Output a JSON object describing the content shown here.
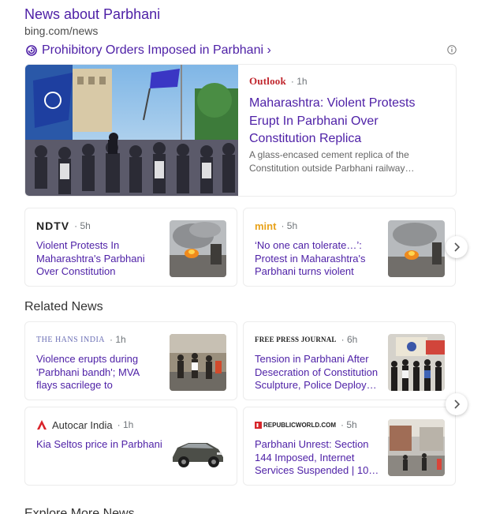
{
  "header": {
    "title": "News about Parbhani",
    "source": "bing.com/news"
  },
  "topic": {
    "label": "Prohibitory Orders Imposed in Parbhani ›"
  },
  "hero": {
    "publisher": "Outlook",
    "time": "· 1h",
    "title": "Maharashtra: Violent Protests Erupt In Parbhani Over Constitution Replica Vandalism;…",
    "snippet": "A glass-encased cement replica of the Constitution outside Parbhani railway…"
  },
  "top_cards": [
    {
      "publisher": "NDTV",
      "time": "· 5h",
      "title": "Violent Protests In Maharashtra's Parbhani Over Constitution Replica…"
    },
    {
      "publisher": "mint",
      "time": "· 5h",
      "title": "‘No one can tolerate…’: Protest in Maharashtra's Parbhani turns violent ove…"
    }
  ],
  "related": {
    "title": "Related News",
    "cards": [
      {
        "publisher": "THE HANS INDIA",
        "time": "· 1h",
        "title": "Violence erupts during 'Parbhani bandh'; MVA flays sacrilege to Ambedkar…"
      },
      {
        "publisher": "FREE PRESS JOURNAL",
        "time": "· 6h",
        "title": "Tension in Parbhani After Desecration of Constitution Sculpture, Police Deploy…"
      },
      {
        "publisher": "Autocar India",
        "time": "· 1h",
        "title": "Kia Seltos price in Parbhani"
      },
      {
        "publisher": "REPUBLICWORLD.COM",
        "time": "· 5h",
        "title": "Parbhani Unrest: Section 144 Imposed, Internet Services Suspended | 10…"
      }
    ]
  },
  "footer": {
    "explore": "Explore More News"
  },
  "colors": {
    "link": "#4d1fa6",
    "outlook_red": "#c0262d",
    "mint_orange": "#e8a21b",
    "autocar_red": "#d9232a"
  }
}
